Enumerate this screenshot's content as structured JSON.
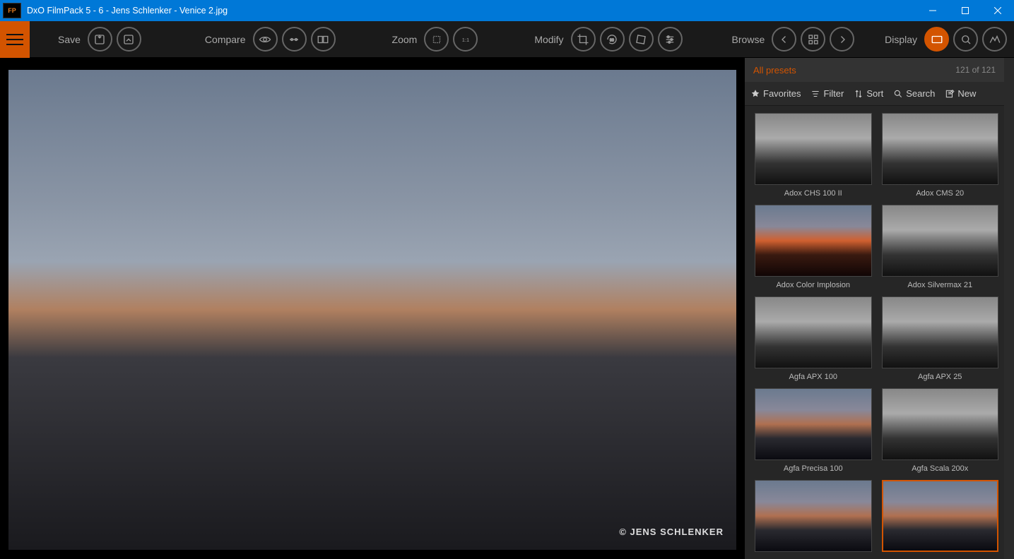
{
  "window": {
    "title": "DxO FilmPack 5 - 6 - Jens Schlenker - Venice 2.jpg",
    "app_badge": "FP"
  },
  "toolbar": {
    "save": "Save",
    "compare": "Compare",
    "zoom": "Zoom",
    "modify": "Modify",
    "browse": "Browse",
    "display": "Display"
  },
  "viewer": {
    "credit": "© JENS SCHLENKER"
  },
  "panel": {
    "title": "All presets",
    "count": "121 of 121",
    "tools": {
      "favorites": "Favorites",
      "filter": "Filter",
      "sort": "Sort",
      "search": "Search",
      "new": "New"
    },
    "presets": [
      {
        "name": "Adox CHS 100 II",
        "style": "bw"
      },
      {
        "name": "Adox CMS 20",
        "style": "bw"
      },
      {
        "name": "Adox Color Implosion",
        "style": "warm"
      },
      {
        "name": "Adox Silvermax 21",
        "style": "bw"
      },
      {
        "name": "Agfa APX 100",
        "style": "bw"
      },
      {
        "name": "Agfa APX 25",
        "style": "bw"
      },
      {
        "name": "Agfa Precisa 100",
        "style": "color"
      },
      {
        "name": "Agfa Scala 200x",
        "style": "bw"
      },
      {
        "name": "",
        "style": "color"
      },
      {
        "name": "",
        "style": "color",
        "selected": true
      }
    ]
  }
}
